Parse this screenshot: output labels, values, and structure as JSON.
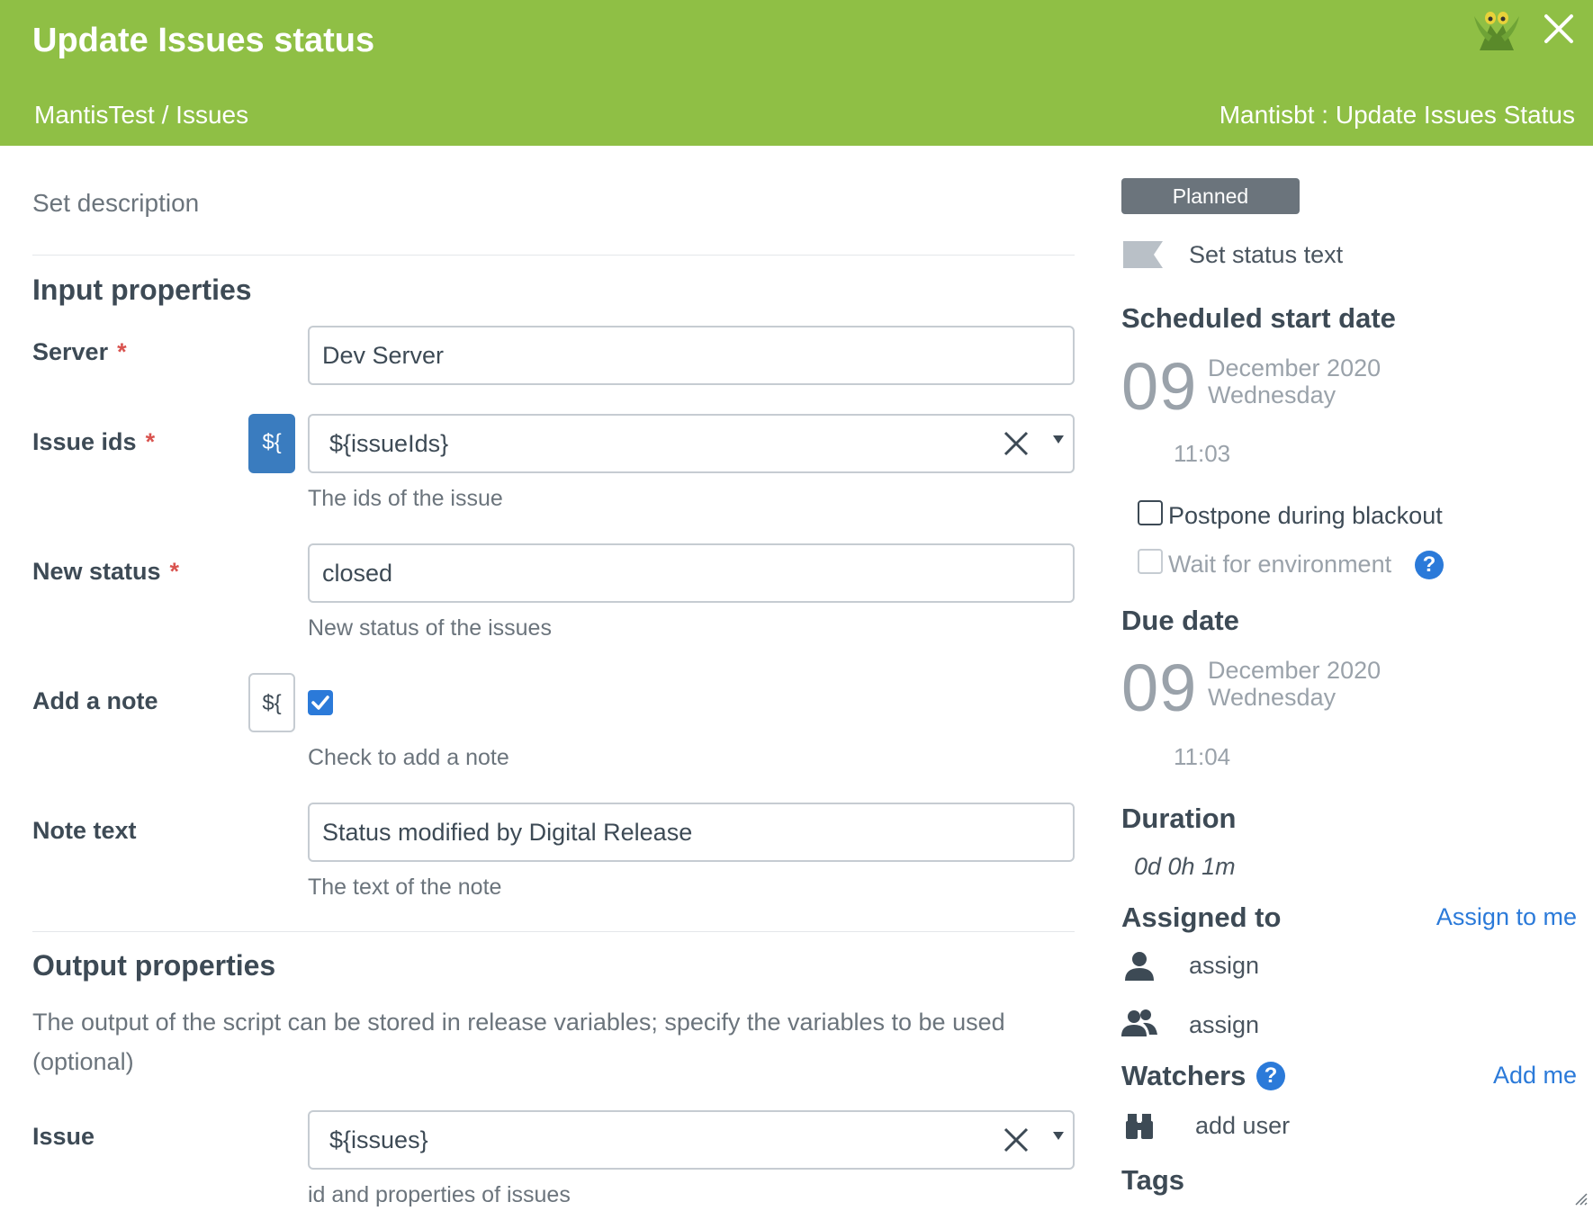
{
  "header": {
    "title": "Update Issues status",
    "breadcrumb": "MantisTest / Issues",
    "plugin_name": "Mantisbt : Update Issues Status"
  },
  "description_placeholder": "Set description",
  "input_section": {
    "title": "Input properties",
    "server": {
      "label": "Server",
      "required": "*",
      "value": "Dev Server"
    },
    "issue_ids": {
      "label": "Issue ids",
      "required": "*",
      "var_button": "${",
      "value": "${issueIds}",
      "help": "The ids of the issue"
    },
    "new_status": {
      "label": "New status",
      "required": "*",
      "value": "closed",
      "help": "New status of the issues"
    },
    "add_note": {
      "label": "Add a note",
      "var_button": "${",
      "checked": true,
      "help": "Check to add a note"
    },
    "note_text": {
      "label": "Note text",
      "value": "Status modified by Digital Release",
      "help": "The text of the note"
    }
  },
  "output_section": {
    "title": "Output properties",
    "description": "The output of the script can be stored in release variables; specify the variables to be used (optional)",
    "issue": {
      "label": "Issue",
      "value": "${issues}",
      "help": "id and properties of issues"
    }
  },
  "sidebar": {
    "status_badge": "Planned",
    "status_text_placeholder": "Set status text",
    "scheduled_start": {
      "title": "Scheduled start date",
      "day": "09",
      "month_year": "December 2020",
      "weekday": "Wednesday",
      "time": "11:03"
    },
    "postpone_label": "Postpone during blackout",
    "wait_env_label": "Wait for environment",
    "help_glyph": "?",
    "due_date": {
      "title": "Due date",
      "day": "09",
      "month_year": "December 2020",
      "weekday": "Wednesday",
      "time": "11:04"
    },
    "duration": {
      "title": "Duration",
      "value": "0d 0h 1m"
    },
    "assigned": {
      "title": "Assigned to",
      "assign_me": "Assign to me",
      "user_placeholder": "assign",
      "team_placeholder": "assign"
    },
    "watchers": {
      "title": "Watchers",
      "add_me": "Add me",
      "add_user": "add user"
    },
    "tags": {
      "title": "Tags"
    }
  },
  "colors": {
    "header": "#8fbf45",
    "accent": "#2b7ad9",
    "required": "#d9534f",
    "badge": "#6b747c"
  },
  "icons": [
    "mantis-logo-icon",
    "close-icon",
    "flag-icon",
    "user-icon",
    "team-icon",
    "binoculars-icon",
    "help-icon",
    "clear-icon",
    "caret-down-icon",
    "resize-handle-icon"
  ]
}
